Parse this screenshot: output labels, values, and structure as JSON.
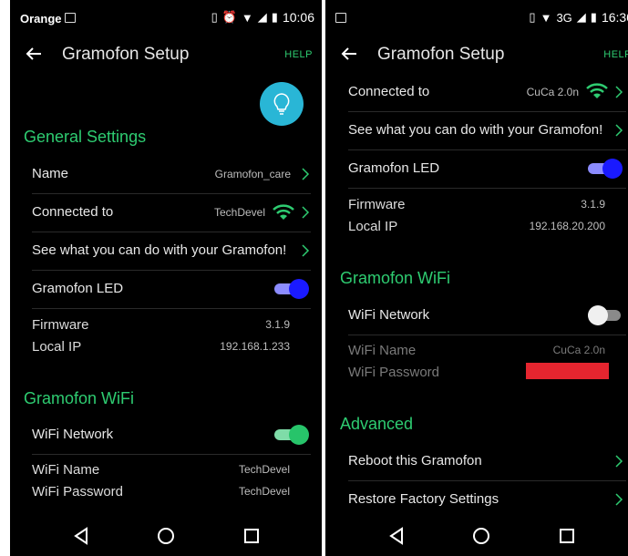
{
  "left": {
    "status": {
      "carrier": "Orange",
      "time": "10:06"
    },
    "appbar": {
      "title": "Gramofon Setup",
      "help": "HELP"
    },
    "general": {
      "heading": "General Settings",
      "name_label": "Name",
      "name_value": "Gramofon_care",
      "connected_label": "Connected to",
      "connected_value": "TechDevel",
      "see_label": "See what you can do with your Gramofon!",
      "led_label": "Gramofon LED",
      "led_on": true,
      "firmware_label": "Firmware",
      "firmware_value": "3.1.9",
      "ip_label": "Local IP",
      "ip_value": "192.168.1.233"
    },
    "wifi": {
      "heading": "Gramofon WiFi",
      "network_label": "WiFi Network",
      "network_on": true,
      "name_label": "WiFi Name",
      "name_value": "TechDevel",
      "password_label": "WiFi Password",
      "password_value": "TechDevel"
    }
  },
  "right": {
    "status": {
      "time": "16:30",
      "network": "3G"
    },
    "appbar": {
      "title": "Gramofon Setup",
      "help": "HELP"
    },
    "general": {
      "connected_label": "Connected to",
      "connected_value": "CuCa 2.0n",
      "see_label": "See what you can do with your Gramofon!",
      "led_label": "Gramofon LED",
      "led_on": true,
      "firmware_label": "Firmware",
      "firmware_value": "3.1.9",
      "ip_label": "Local IP",
      "ip_value": "192.168.20.200"
    },
    "wifi": {
      "heading": "Gramofon WiFi",
      "network_label": "WiFi Network",
      "network_on": false,
      "name_label": "WiFi Name",
      "name_value": "CuCa 2.0n",
      "password_label": "WiFi Password"
    },
    "advanced": {
      "heading": "Advanced",
      "reboot_label": "Reboot this Gramofon",
      "restore_label": "Restore Factory Settings"
    }
  },
  "colors": {
    "accent": "#2ecc71",
    "led_toggle": "#1a1aff",
    "fab": "#29b6d6",
    "redaction": "#e5252f"
  }
}
